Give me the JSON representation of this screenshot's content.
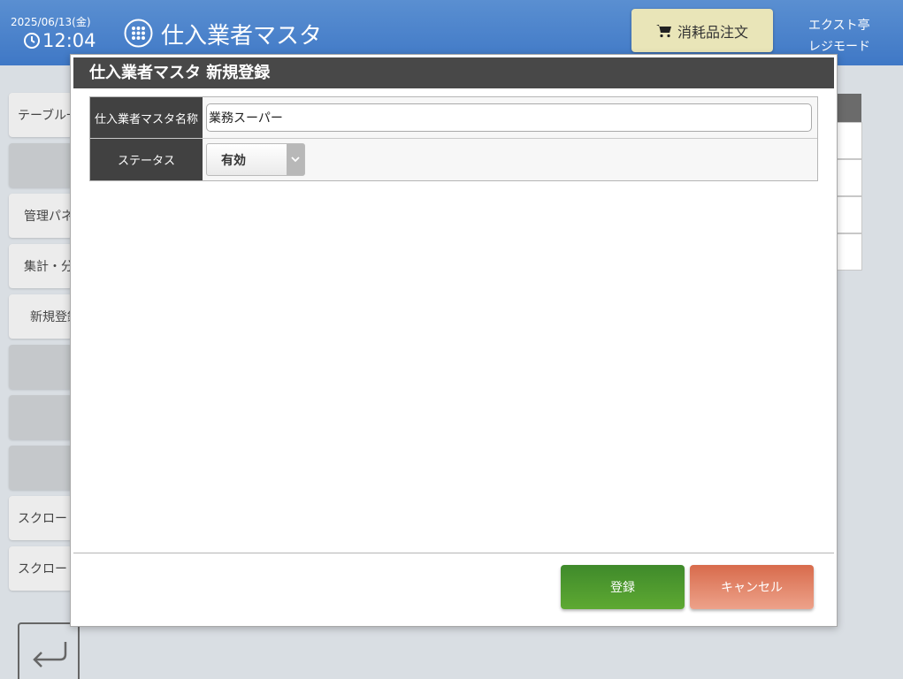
{
  "header": {
    "date": "2025/06/13(金)",
    "time": "12:04",
    "app_title": "仕入業者マスタ",
    "order_button": "消耗品注文",
    "shop_name": "エクスト亭",
    "mode": "レジモード"
  },
  "sidebar": {
    "items": [
      {
        "label": "テーブル一"
      },
      {
        "label": ""
      },
      {
        "label": "管理パネ"
      },
      {
        "label": "集計・分"
      },
      {
        "label": "新規登録"
      },
      {
        "label": ""
      },
      {
        "label": ""
      },
      {
        "label": ""
      },
      {
        "label": "スクロー"
      },
      {
        "label": "スクロー"
      }
    ]
  },
  "modal": {
    "title": "仕入業者マスタ 新規登録",
    "fields": {
      "name_label": "仕入業者マスタ名称",
      "name_value": "業務スーパー",
      "status_label": "ステータス",
      "status_value": "有効"
    },
    "register_button": "登録",
    "cancel_button": "キャンセル"
  },
  "colors": {
    "header_blue": "#4a82cc",
    "order_button_bg": "#e9e5b8",
    "register_green": "#4c992f",
    "cancel_orange": "#e0816a",
    "label_dark": "#414141"
  }
}
